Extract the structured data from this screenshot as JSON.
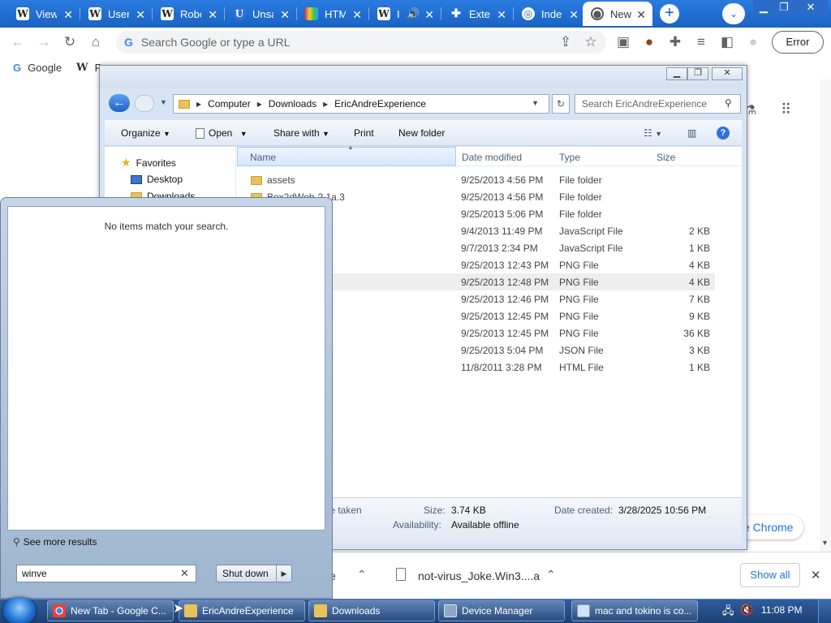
{
  "browser": {
    "tabs": [
      {
        "label": "View",
        "icon": "W"
      },
      {
        "label": "User",
        "icon": "W"
      },
      {
        "label": "Robo",
        "icon": "W"
      },
      {
        "label": "Unsa",
        "icon": "U"
      },
      {
        "label": "HTM",
        "icon": "rainbow"
      },
      {
        "label": "I",
        "icon": "W"
      },
      {
        "label": "Exte",
        "icon": "puzzle"
      },
      {
        "label": "Inde",
        "icon": "globe"
      },
      {
        "label": "New",
        "icon": "chrome"
      }
    ],
    "omnibox_placeholder": "Search Google or type a URL",
    "error_label": "Error",
    "bookmarks": [
      {
        "label": "Google"
      },
      {
        "label": "R"
      }
    ],
    "chrome_button_label": "e Chrome"
  },
  "explorer": {
    "breadcrumb": [
      "Computer",
      "Downloads",
      "EricAndreExperience"
    ],
    "search_placeholder": "Search EricAndreExperience",
    "commands": {
      "organize": "Organize",
      "open": "Open",
      "share": "Share with",
      "print": "Print",
      "new_folder": "New folder"
    },
    "nav": {
      "favorites": "Favorites",
      "desktop": "Desktop",
      "downloads": "Downloads"
    },
    "columns": {
      "name": "Name",
      "date": "Date modified",
      "type": "Type",
      "size": "Size"
    },
    "files": [
      {
        "name": "assets",
        "date": "9/25/2013 4:56 PM",
        "type": "File folder",
        "size": ""
      },
      {
        "name": "Box2dWeb-2.1a.3",
        "date": "9/25/2013 4:56 PM",
        "type": "File folder",
        "size": ""
      },
      {
        "name": "",
        "date": "9/25/2013 5:06 PM",
        "type": "File folder",
        "size": ""
      },
      {
        "name": "",
        "date": "9/4/2013 11:49 PM",
        "type": "JavaScript File",
        "size": "2 KB"
      },
      {
        "name": "",
        "date": "9/7/2013 2:34 PM",
        "type": "JavaScript File",
        "size": "1 KB"
      },
      {
        "name": "",
        "date": "9/25/2013 12:43 PM",
        "type": "PNG File",
        "size": "4 KB"
      },
      {
        "name": "",
        "date": "9/25/2013 12:48 PM",
        "type": "PNG File",
        "size": "4 KB"
      },
      {
        "name": "",
        "date": "9/25/2013 12:46 PM",
        "type": "PNG File",
        "size": "7 KB"
      },
      {
        "name": "",
        "date": "9/25/2013 12:45 PM",
        "type": "PNG File",
        "size": "9 KB"
      },
      {
        "name": "",
        "date": "9/25/2013 12:45 PM",
        "type": "PNG File",
        "size": "36 KB"
      },
      {
        "name": "",
        "date": "9/25/2013 5:04 PM",
        "type": "JSON File",
        "size": "3 KB"
      },
      {
        "name": "",
        "date": "11/8/2011 3:28 PM",
        "type": "HTML File",
        "size": "1 KB"
      }
    ],
    "details": {
      "taken_label": "te taken",
      "size_label": "Size:",
      "size_value": "3.74 KB",
      "availability_label": "Availability:",
      "availability_value": "Available offline",
      "created_label": "Date created:",
      "created_value": "3/28/2025 10:56 PM"
    }
  },
  "start_menu": {
    "no_items": "No items match your search.",
    "see_more": "See more results",
    "search_value": "winve",
    "shutdown_label": "Shut down"
  },
  "downloads_bar": {
    "partial_left": "e",
    "file_name": "not-virus_Joke.Win3....a",
    "show_all": "Show all"
  },
  "taskbar": {
    "items": [
      {
        "label": "New Tab - Google C..."
      },
      {
        "label": "EricAndreExperience"
      },
      {
        "label": "Downloads"
      },
      {
        "label": "Device Manager"
      },
      {
        "label": "mac and tokino is co..."
      }
    ],
    "clock": "11:08 PM"
  }
}
